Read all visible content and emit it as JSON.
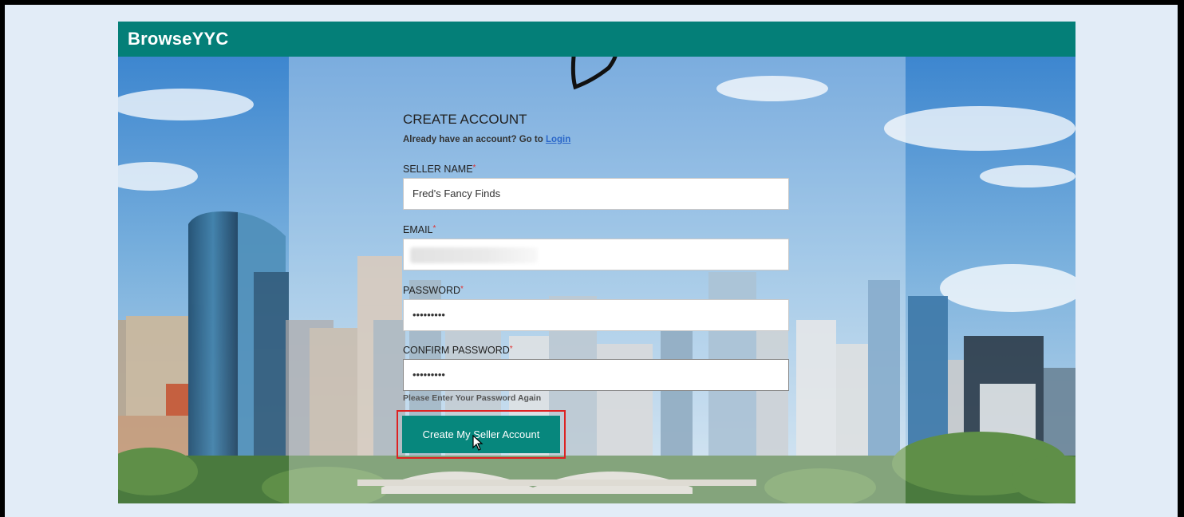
{
  "app": {
    "brand": "BrowseYYC"
  },
  "form": {
    "heading": "CREATE ACCOUNT",
    "login_prompt": "Already have an account? Go to",
    "login_link": "Login",
    "required_marker": "*",
    "seller_name": {
      "label": "SELLER NAME",
      "value": "Fred's Fancy Finds"
    },
    "email": {
      "label": "EMAIL",
      "value": ""
    },
    "password": {
      "label": "PASSWORD",
      "value": "•••••••••"
    },
    "confirm_password": {
      "label": "CONFIRM PASSWORD",
      "value": "•••••••••"
    },
    "confirm_hint": "Please Enter Your Password Again",
    "submit_label": "Create My Seller Account"
  },
  "colors": {
    "brand_bar": "#047f78",
    "button": "#07877d",
    "highlight": "#dd2222",
    "link": "#2a66c9"
  }
}
